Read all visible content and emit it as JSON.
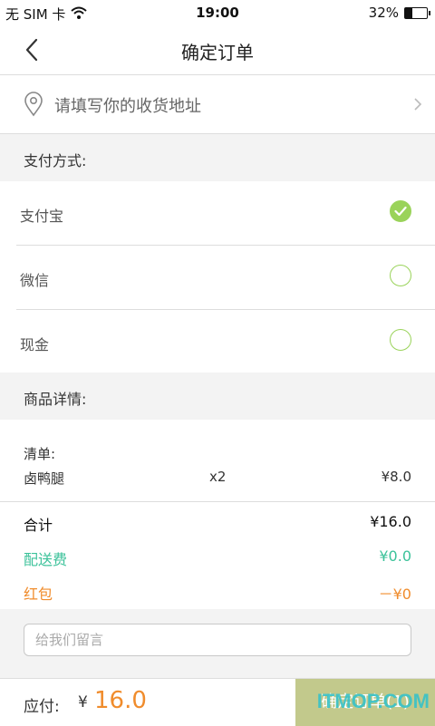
{
  "status": {
    "carrier": "无 SIM 卡",
    "time": "19:00",
    "battery_text": "32%",
    "battery_level": 0.32
  },
  "nav": {
    "title": "确定订单",
    "back_icon": "chevron-left-icon"
  },
  "address": {
    "placeholder": "请填写你的收货地址",
    "icon": "location-pin-icon"
  },
  "payment": {
    "section_label": "支付方式:",
    "methods": [
      {
        "label": "支付宝",
        "selected": true
      },
      {
        "label": "微信",
        "selected": false
      },
      {
        "label": "现金",
        "selected": false
      }
    ],
    "accent": "#9ad35a"
  },
  "details": {
    "section_label": "商品详情:",
    "list_title": "清单:",
    "items": [
      {
        "name": "卤鸭腿",
        "qty": "x2",
        "price": "¥8.0"
      }
    ]
  },
  "summary": {
    "total_label": "合计",
    "total_value": "¥16.0",
    "delivery_label": "配送费",
    "delivery_value": "¥0.0",
    "redpack_label": "红包",
    "redpack_value": "－¥0",
    "colors": {
      "delivery": "#3cc29a",
      "redpack": "#f08c2c"
    }
  },
  "comment": {
    "placeholder": "给我们留言"
  },
  "bottom": {
    "pay_label": "应付:",
    "currency": "¥",
    "amount": "16.0",
    "submit_label": "确定订单(1)",
    "submit_color": "#c2c98c"
  },
  "watermark": "ITMOP.COM"
}
